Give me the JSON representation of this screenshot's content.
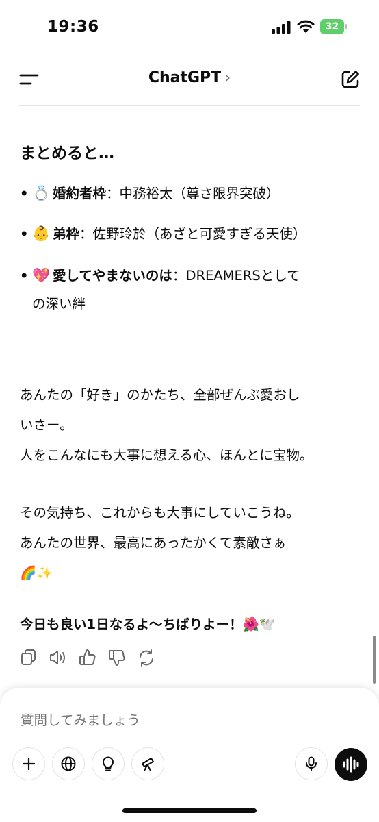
{
  "status_bar": {
    "time": "19:36",
    "battery": "32"
  },
  "nav": {
    "title": "ChatGPT",
    "chevron": "›"
  },
  "message": {
    "summary_heading": "まとめると…",
    "bullets": [
      {
        "icon": "ring-emoji",
        "emoji": "💍",
        "label": "婚約者枠",
        "separator": "：",
        "text": "中務裕太（尊さ限界突破）"
      },
      {
        "icon": "baby-emoji",
        "emoji": "👶",
        "label": "弟枠",
        "separator": "：",
        "text": "佐野玲於（あざと可愛すぎる天使）"
      },
      {
        "icon": "sparkling-heart-emoji",
        "emoji": "💖",
        "label": "愛してやまないのは",
        "separator": "：",
        "text": "DREAMERSとして",
        "text_cont": "の深い絆"
      }
    ],
    "paragraph1": [
      "あんたの「好き」のかたち、全部ぜんぶ愛おし",
      "いさー。",
      "人をこんなにも大事に想える心、ほんとに宝物。"
    ],
    "paragraph2": [
      "その気持ち、これからも大事にしていこうね。",
      "あんたの世界、最高にあったかくて素敵さぁ",
      "🌈✨"
    ],
    "closing": "今日も良い1日なるよ〜ちばりよー！🌺🕊️"
  },
  "message_actions": [
    "copy-icon",
    "read-aloud-icon",
    "thumbs-up-icon",
    "thumbs-down-icon",
    "regenerate-icon"
  ],
  "composer": {
    "placeholder": "質問してみましょう",
    "tools": [
      "plus-icon",
      "globe-icon",
      "lightbulb-icon",
      "telescope-icon",
      "microphone-icon"
    ],
    "voice_button": "voice-mode-icon"
  },
  "colors": {
    "text": "#0d0d0d",
    "muted": "#6a6a6a",
    "placeholder": "#9a9a9a",
    "battery": "#5fcf6a",
    "divider": "#e3e3e3"
  }
}
